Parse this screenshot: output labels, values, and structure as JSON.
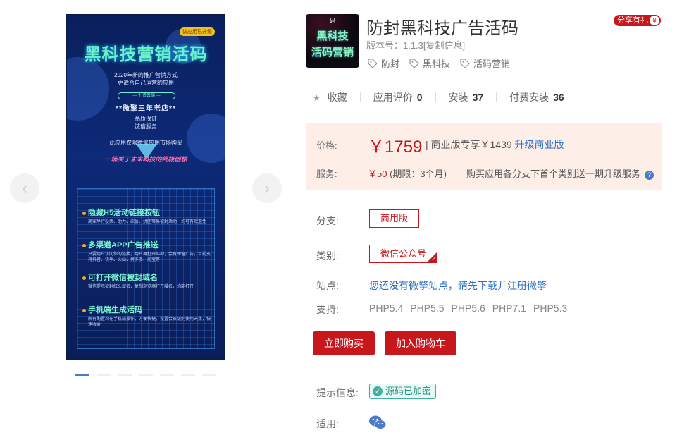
{
  "gallery": {
    "prev_icon": "chevron-left-icon",
    "next_icon": "chevron-right-icon",
    "poster": {
      "corner_tag": "该应用已升级",
      "title": "黑科技营销活码",
      "line1": "2020年新的推广营销方式",
      "line2": "更适合自己运营的应用",
      "pill": "— 七贤云端 —",
      "big1": "**微擎三年老店**",
      "line3": "品质保证",
      "line4": "诚信服务",
      "line5": "此应用仅限微擎应用市场购买",
      "slogan": "一场关于未来科技的终极创想",
      "features": [
        {
          "title": "隐藏H5活动链接按钮",
          "desc": "商家举行投票、助力、砍价、拼团等易被封活动，均可有效避免"
        },
        {
          "title": "多渠道APP广告推送",
          "desc": "只要用户访问你的链接，用户再打开APP，会有弹窗广告，目前支持抖音、快手、火山、拼多多、淘宝等"
        },
        {
          "title": "可打开微信被封域名",
          "desc": "微信提示被封红头域名，复制浏览器打开域名，均能打开"
        },
        {
          "title": "手机端生成活码",
          "desc": "所有配置均在手机端操作，方便快捷，设置会员级别使用天数，快速收益"
        }
      ]
    },
    "dots": 7,
    "active_dot": 0
  },
  "app": {
    "icon_top": "码",
    "icon_line1": "黑科技",
    "icon_line2": "活码营销",
    "title": "防封黑科技广告活码",
    "version": "版本号：1.1.3[复制信息]",
    "tags": [
      "防封",
      "黑科技",
      "活码营销"
    ],
    "share_label": "分享有礼",
    "gift_glyph": "¥"
  },
  "stats": {
    "favorite": "收藏",
    "rating_label": "应用评价",
    "rating_value": "0",
    "installs_label": "安装",
    "installs_value": "37",
    "paid_label": "付费安装",
    "paid_value": "36"
  },
  "price": {
    "label": "价格:",
    "value": "￥1759",
    "extra": "| 商业版专享￥1439",
    "upgrade_link": "升级商业版",
    "service_label": "服务:",
    "service_value": "￥50",
    "service_period": "(期限：3个月)",
    "service_desc": "购买应用各分支下首个类别送一期升级服务",
    "help_glyph": "?"
  },
  "options": {
    "branch_label": "分支:",
    "branch_value": "商用版",
    "category_label": "类别:",
    "category_value": "微信公众号",
    "site_label": "站点:",
    "site_text": "您还没有微擎站点，请先下载并注册微擎",
    "support_label": "支持:",
    "support_versions": [
      "PHP5.4",
      "PHP5.5",
      "PHP5.6",
      "PHP7.1",
      "PHP5.3"
    ]
  },
  "actions": {
    "buy": "立即购买",
    "cart": "加入购物车"
  },
  "info": {
    "hint_label": "提示信息:",
    "encrypt_badge": "源码已加密",
    "apply_label": "适用:",
    "apply_icon": "wechat-icon"
  },
  "colors": {
    "accent_red": "#c8161d",
    "link_blue": "#2a6fc0",
    "price_bg": "#fdeee8"
  }
}
